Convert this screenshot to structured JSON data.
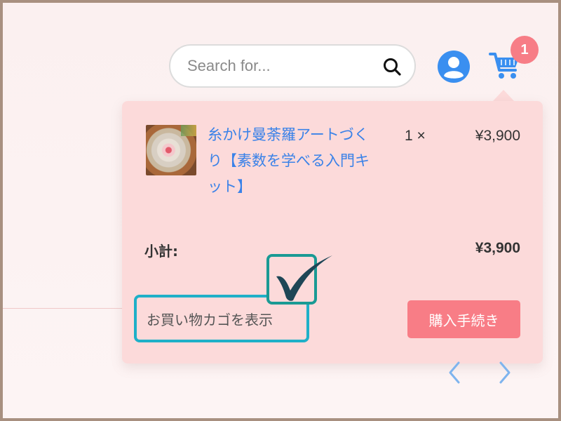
{
  "header": {
    "search": {
      "placeholder": "Search for...",
      "value": ""
    },
    "cart_badge": "1"
  },
  "cart_dropdown": {
    "items": [
      {
        "name": "糸かけ曼荼羅アートづくり【素数を学べる入門キット】",
        "quantity": "1 ×",
        "price": "¥3,900"
      }
    ],
    "subtotal_label": "小計:",
    "subtotal_value": "¥3,900",
    "view_cart_label": "お買い物カゴを表示",
    "checkout_label": "購入手続き"
  },
  "icons": {
    "search": "search-icon",
    "user": "user-icon",
    "cart": "cart-icon",
    "check": "check-icon",
    "prev": "chevron-left-icon",
    "next": "chevron-right-icon"
  },
  "colors": {
    "accent_blue": "#3a82e8",
    "badge": "#f77d86",
    "checkout_button": "#f87d86",
    "dropdown_bg": "#fcdada",
    "highlight_border": "#1fb0c8",
    "check_border": "#1a9a94"
  }
}
